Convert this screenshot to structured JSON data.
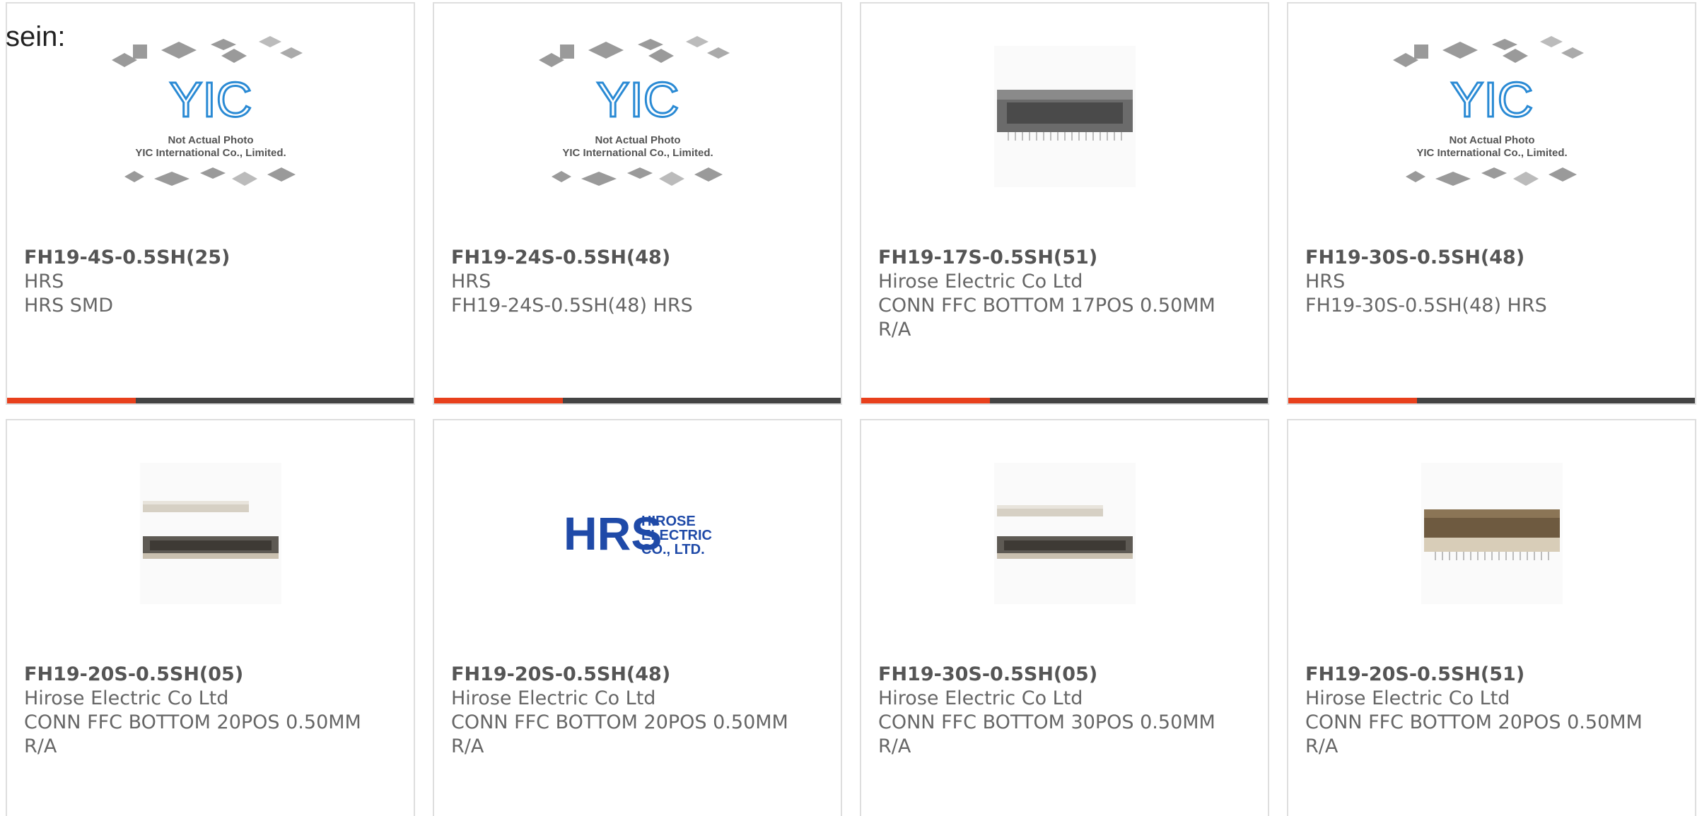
{
  "heading": "sein:",
  "placeholder": {
    "line1": "Not Actual Photo",
    "line2": "YIC International Co., Limited.",
    "logo_text": "YIC"
  },
  "hrs_logo": {
    "letters": "HRS",
    "line1": "HIROSE",
    "line2": "ELECTRIC",
    "line3": "CO., LTD."
  },
  "colors": {
    "accent": "#e8401c",
    "bar": "#444444",
    "border": "#dedede",
    "text": "#555555",
    "yic_blue": "#2a8ad4",
    "hrs_blue": "#1f4aa8"
  },
  "products": [
    {
      "part_number": "FH19-4S-0.5SH(25)",
      "manufacturer": "HRS",
      "description": "HRS SMD",
      "image": "placeholder-yic",
      "has_progress_bar": true
    },
    {
      "part_number": "FH19-24S-0.5SH(48)",
      "manufacturer": "HRS",
      "description": "FH19-24S-0.5SH(48) HRS",
      "image": "placeholder-yic",
      "has_progress_bar": true
    },
    {
      "part_number": "FH19-17S-0.5SH(51)",
      "manufacturer": "Hirose Electric Co Ltd",
      "description": "CONN FFC BOTTOM 17POS 0.50MM R/A",
      "image": "connector-dark",
      "has_progress_bar": true
    },
    {
      "part_number": "FH19-30S-0.5SH(48)",
      "manufacturer": "HRS",
      "description": "FH19-30S-0.5SH(48) HRS",
      "image": "placeholder-yic",
      "has_progress_bar": true
    },
    {
      "part_number": "FH19-20S-0.5SH(05)",
      "manufacturer": "Hirose Electric Co Ltd",
      "description": "CONN FFC BOTTOM 20POS 0.50MM R/A",
      "image": "connector-pair",
      "has_progress_bar": false
    },
    {
      "part_number": "FH19-20S-0.5SH(48)",
      "manufacturer": "Hirose Electric Co Ltd",
      "description": "CONN FFC BOTTOM 20POS 0.50MM R/A",
      "image": "hrs-logo",
      "has_progress_bar": false
    },
    {
      "part_number": "FH19-30S-0.5SH(05)",
      "manufacturer": "Hirose Electric Co Ltd",
      "description": "CONN FFC BOTTOM 30POS 0.50MM R/A",
      "image": "connector-pair",
      "has_progress_bar": false
    },
    {
      "part_number": "FH19-20S-0.5SH(51)",
      "manufacturer": "Hirose Electric Co Ltd",
      "description": "CONN FFC BOTTOM 20POS 0.50MM R/A",
      "image": "connector-light",
      "has_progress_bar": false
    }
  ]
}
